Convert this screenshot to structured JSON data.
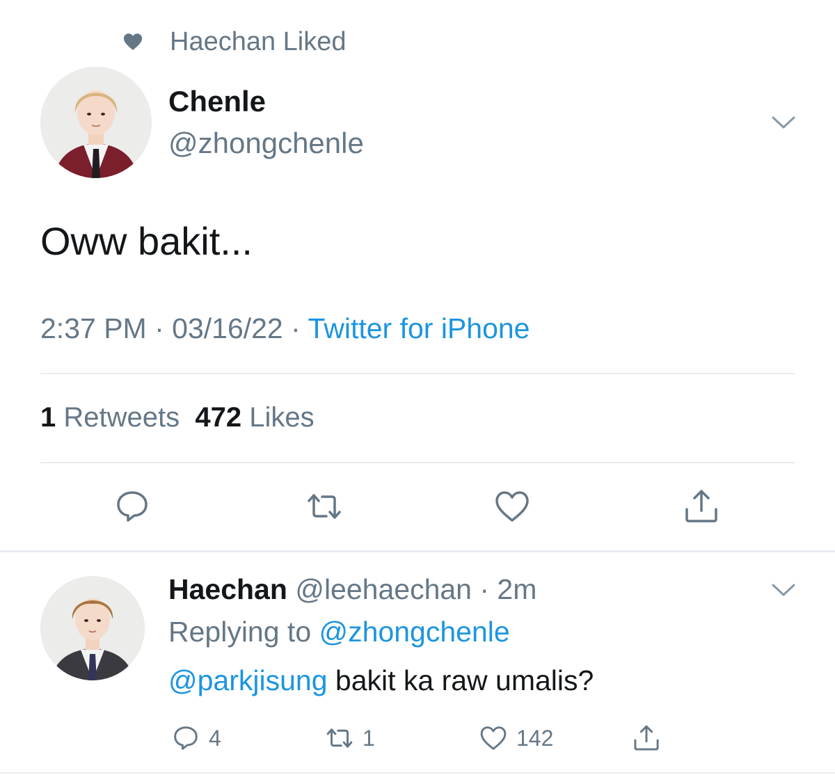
{
  "social_context": {
    "icon": "heart-icon",
    "text": "Haechan Liked"
  },
  "tweet": {
    "author": {
      "name": "Chenle",
      "handle": "@zhongchenle",
      "avatar": "avatar-chenle"
    },
    "text": "Oww bakit...",
    "time": "2:37 PM",
    "sep1": " · ",
    "date": "03/16/22",
    "sep2": " · ",
    "source": "Twitter for iPhone",
    "retweets": {
      "count": "1",
      "label": "Retweets"
    },
    "likes": {
      "count": "472",
      "label": "Likes"
    },
    "actions": [
      "reply-icon",
      "retweet-icon",
      "like-icon",
      "share-icon"
    ]
  },
  "reply": {
    "author": {
      "name": "Haechan",
      "handle": "@leehaechan",
      "sep": " · ",
      "time": "2m",
      "avatar": "avatar-haechan"
    },
    "replying_prefix": "Replying to ",
    "replying_to": "@zhongchenle",
    "mention": "@parkjisung",
    "text": " bakit ka raw umalis?",
    "counts": {
      "replies": "4",
      "retweets": "1",
      "likes": "142"
    }
  },
  "colors": {
    "link": "#1b95e0",
    "secondary": "#657786",
    "primary": "#14171a",
    "divider": "#e6ecf0"
  }
}
